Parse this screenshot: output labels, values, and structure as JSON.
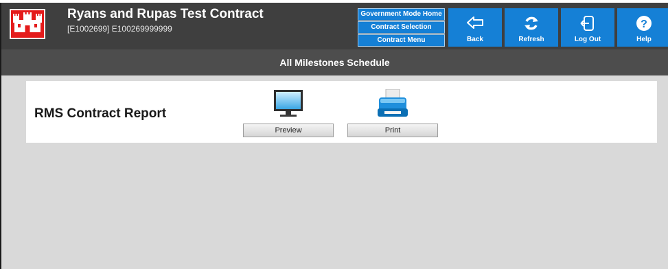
{
  "header": {
    "title": "Ryans and Rupas Test Contract",
    "subtitle": "[E1002699] E100269999999",
    "nav_links": [
      {
        "label": "Government Mode Home"
      },
      {
        "label": "Contract Selection"
      },
      {
        "label": "Contract Menu"
      }
    ],
    "toolbar": [
      {
        "label": "Back",
        "icon": "back-arrow-icon"
      },
      {
        "label": "Refresh",
        "icon": "refresh-icon"
      },
      {
        "label": "Log Out",
        "icon": "logout-icon"
      },
      {
        "label": "Help",
        "icon": "help-icon"
      }
    ]
  },
  "page": {
    "title": "All Milestones Schedule"
  },
  "report": {
    "title": "RMS Contract Report",
    "actions": [
      {
        "label": "Preview",
        "icon": "monitor-icon"
      },
      {
        "label": "Print",
        "icon": "printer-icon"
      }
    ]
  },
  "colors": {
    "header_bg": "#3f3f3f",
    "titlebar_bg": "#4d4d4d",
    "button_blue": "#1580d6",
    "logo_red": "#e41b1b",
    "content_bg": "#d9d9d9"
  }
}
